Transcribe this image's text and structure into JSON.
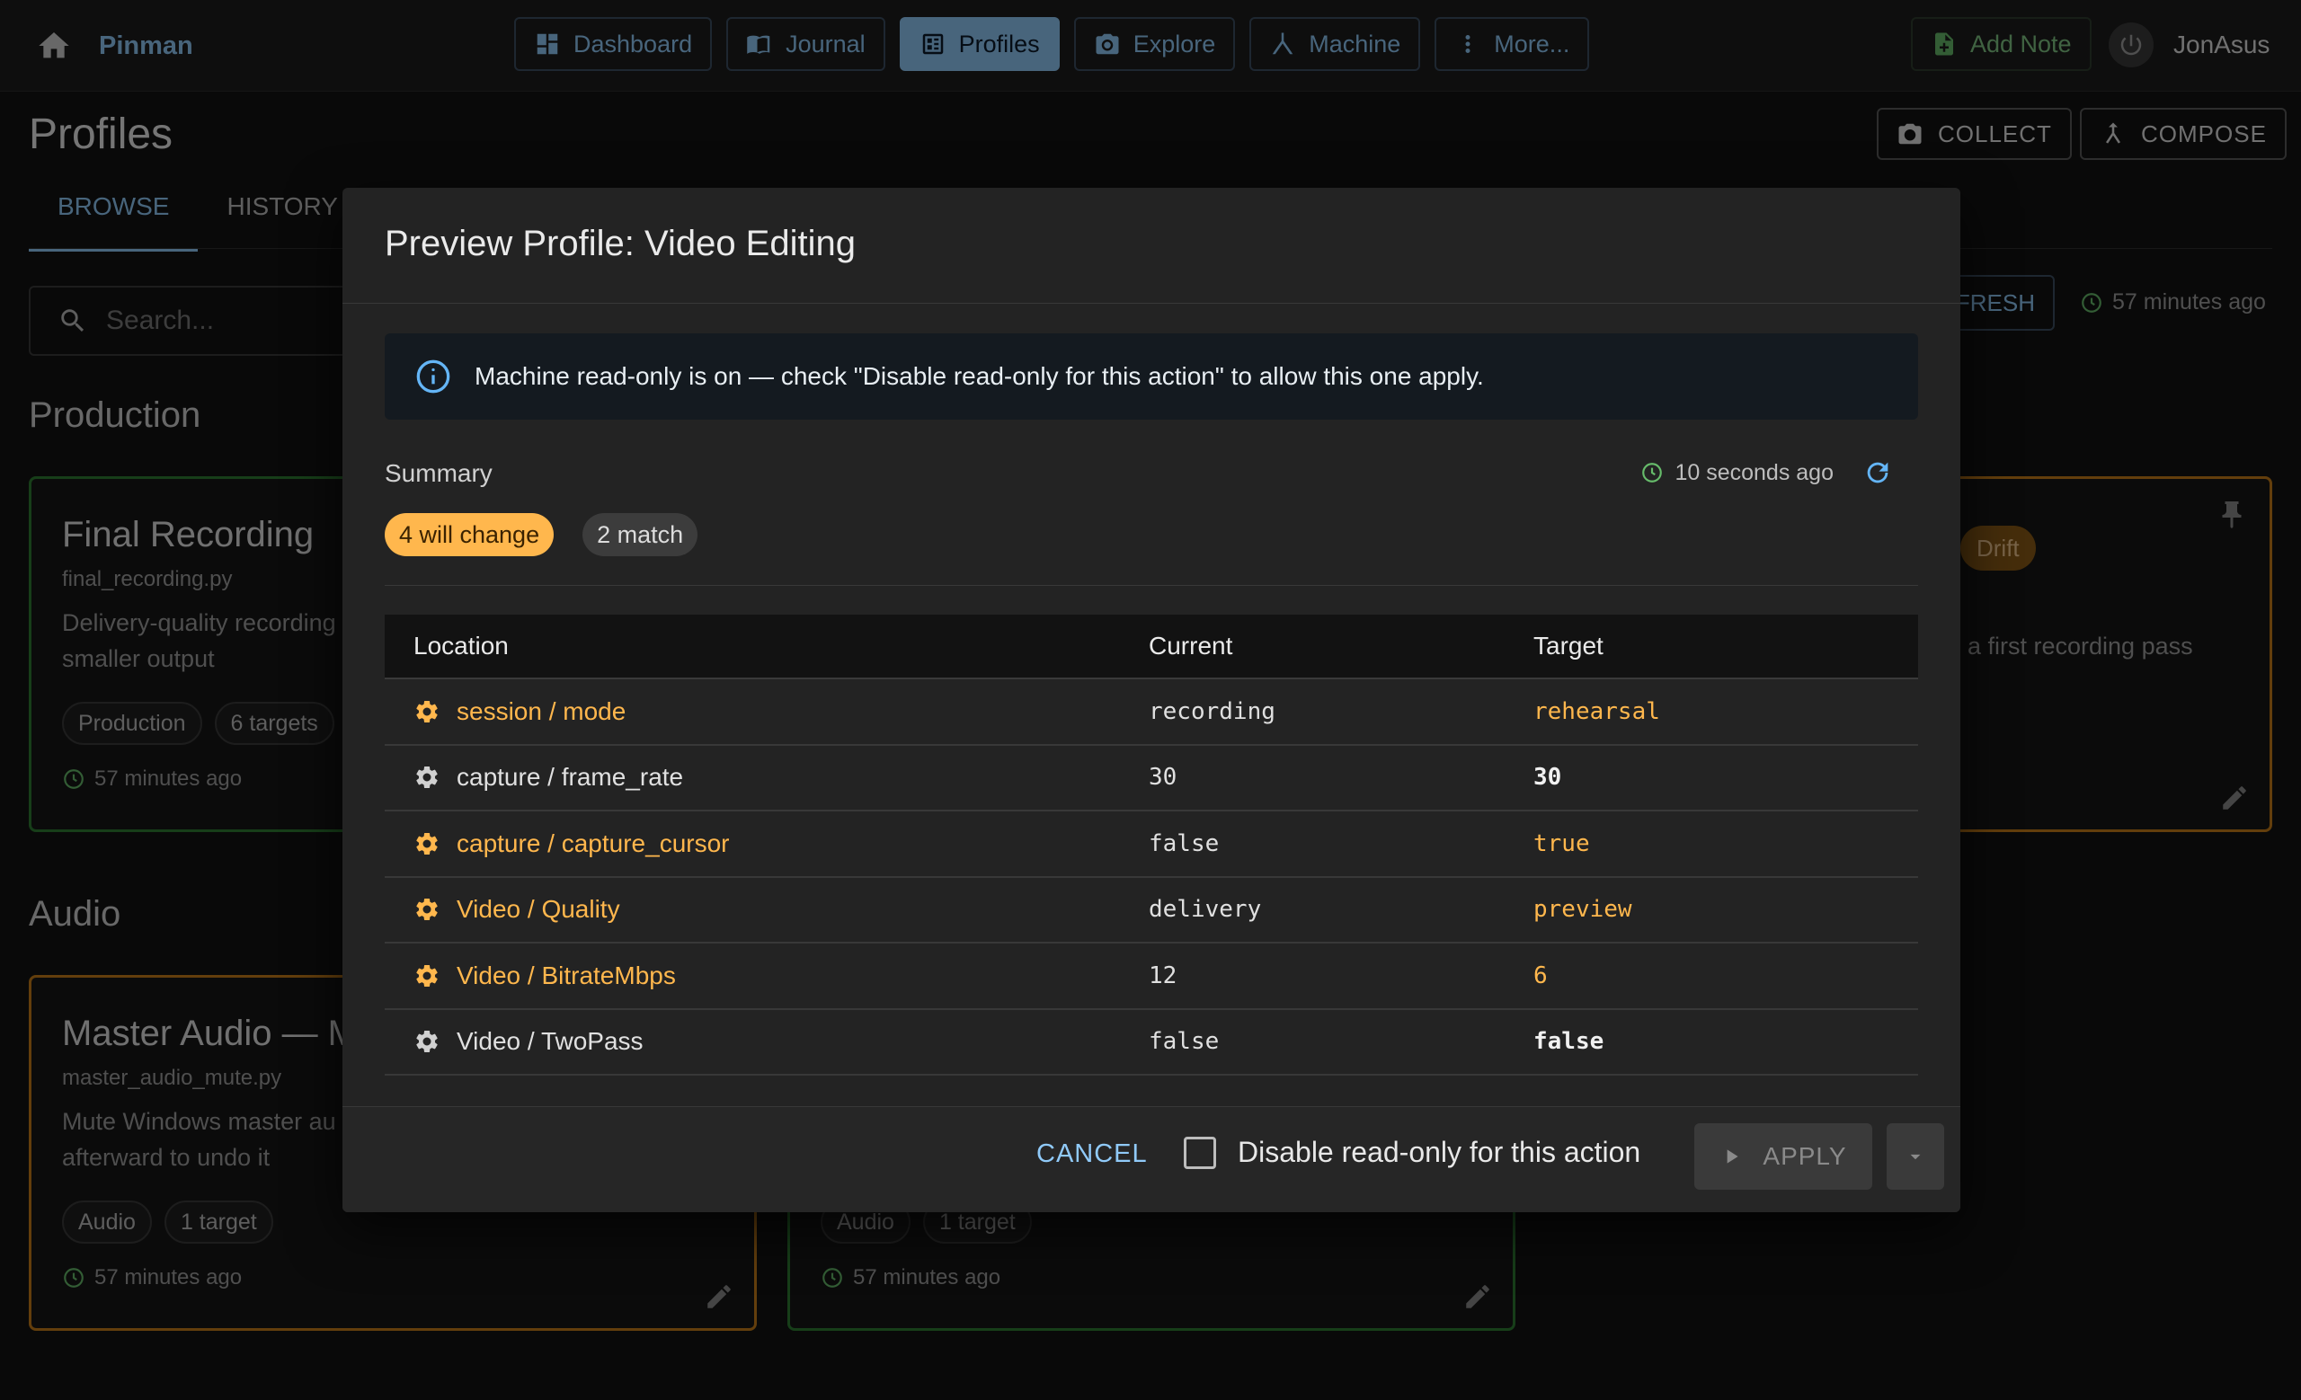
{
  "app": {
    "name": "Pinman",
    "user": "JonAsus"
  },
  "nav": [
    {
      "label": "Dashboard",
      "icon": "dashboard-icon",
      "active": false
    },
    {
      "label": "Journal",
      "icon": "book-icon",
      "active": false
    },
    {
      "label": "Profiles",
      "icon": "profile-list-icon",
      "active": true
    },
    {
      "label": "Explore",
      "icon": "camera-icon",
      "active": false
    },
    {
      "label": "Machine",
      "icon": "tree-icon",
      "active": false
    },
    {
      "label": "More...",
      "icon": "more-vertical-icon",
      "active": false
    }
  ],
  "header": {
    "add_note": "Add Note"
  },
  "page": {
    "title": "Profiles",
    "tabs": [
      "BROWSE",
      "HISTORY"
    ],
    "collect": "COLLECT",
    "compose": "COMPOSE",
    "search_placeholder": "Search...",
    "refresh": "REFRESH",
    "updated": "57 minutes ago"
  },
  "sections": {
    "production": {
      "title": "Production",
      "cards": [
        {
          "title": "Final Recording",
          "file": "final_recording.py",
          "desc1": "Delivery-quality recording",
          "desc2": "smaller output",
          "chips": [
            "Production",
            "6 targets"
          ],
          "time": "57 minutes ago"
        },
        {
          "desc1": "a first recording pass",
          "badge": "Drift"
        }
      ]
    },
    "audio": {
      "title": "Audio",
      "cards": [
        {
          "title": "Master Audio — M",
          "file": "master_audio_mute.py",
          "desc1": "Mute Windows master au",
          "desc2": "afterward to undo it",
          "chips": [
            "Audio",
            "1 target"
          ],
          "time": "57 minutes ago"
        },
        {
          "chips": [
            "Audio",
            "1 target"
          ],
          "time": "57 minutes ago"
        }
      ]
    }
  },
  "dialog": {
    "title": "Preview Profile: Video Editing",
    "info": "Machine read-only is on — check \"Disable read-only for this action\" to allow this one apply.",
    "summary_label": "Summary",
    "summary_time": "10 seconds ago",
    "badges": {
      "change": "4 will change",
      "match": "2 match"
    },
    "columns": [
      "Location",
      "Current",
      "Target"
    ],
    "rows": [
      {
        "location": "session / mode",
        "current": "recording",
        "target": "rehearsal",
        "changed": true
      },
      {
        "location": "capture / frame_rate",
        "current": "30",
        "target": "30",
        "changed": false
      },
      {
        "location": "capture / capture_cursor",
        "current": "false",
        "target": "true",
        "changed": true
      },
      {
        "location": "Video / Quality",
        "current": "delivery",
        "target": "preview",
        "changed": true
      },
      {
        "location": "Video / BitrateMbps",
        "current": "12",
        "target": "6",
        "changed": true
      },
      {
        "location": "Video / TwoPass",
        "current": "false",
        "target": "false",
        "changed": false
      }
    ],
    "cancel": "CANCEL",
    "disable_readonly": "Disable read-only for this action",
    "apply": "APPLY"
  },
  "colors": {
    "accent": "#90caf9",
    "change": "#ffb74d",
    "ok": "#66bb6a"
  }
}
